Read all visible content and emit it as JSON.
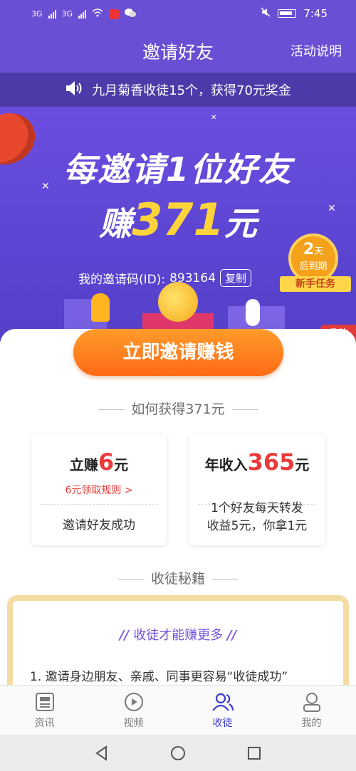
{
  "status_bar": {
    "network1": "3G",
    "network2": "3G",
    "time": "7:45"
  },
  "header": {
    "title": "邀请好友",
    "rules_link": "活动说明"
  },
  "notice": {
    "text": "九月菊香收徒15个，获得70元奖金"
  },
  "hero": {
    "headline_line1": "每邀请1位好友",
    "headline_earn_prefix": "赚",
    "headline_amount": "371",
    "headline_earn_suffix": "元",
    "invite_code_label": "我的邀请码(ID):",
    "invite_code": "893164",
    "copy_label": "复制",
    "badge_days_num": "2",
    "badge_days_unit": "天",
    "badge_expire": "后到期",
    "badge_ribbon": "新手任务",
    "invite_button": "立即邀请赚钱",
    "my_apprentice_line1": "我的",
    "my_apprentice_line2": "徒弟"
  },
  "how_to": {
    "title": "如何获得371元",
    "card_left": {
      "prefix": "立赚",
      "amount": "6",
      "suffix": "元",
      "rule_link": "6元领取规则 >",
      "desc": "邀请好友成功"
    },
    "card_right": {
      "prefix": "年收入",
      "amount": "365",
      "suffix": "元",
      "desc_line1": "1个好友每天转发",
      "desc_line2": "收益5元，你拿1元"
    }
  },
  "secrets": {
    "section_title": "收徒秘籍",
    "box_title": "收徒才能赚更多",
    "item1": "1. 邀请身边朋友、亲戚、同事更容易“收徒成功”"
  },
  "bottom_nav": [
    {
      "label": "资讯",
      "icon": "news-icon"
    },
    {
      "label": "视频",
      "icon": "video-icon"
    },
    {
      "label": "收徒",
      "icon": "apprentice-icon"
    },
    {
      "label": "我的",
      "icon": "profile-icon"
    }
  ],
  "colors": {
    "brand_purple": "#6a4fd4",
    "notice_bg": "#4d3aa9",
    "accent_red": "#e93a3a",
    "amount_yellow": "#ffd43a",
    "button_orange": "#ff7a1c",
    "nav_active": "#3b3bd0"
  }
}
